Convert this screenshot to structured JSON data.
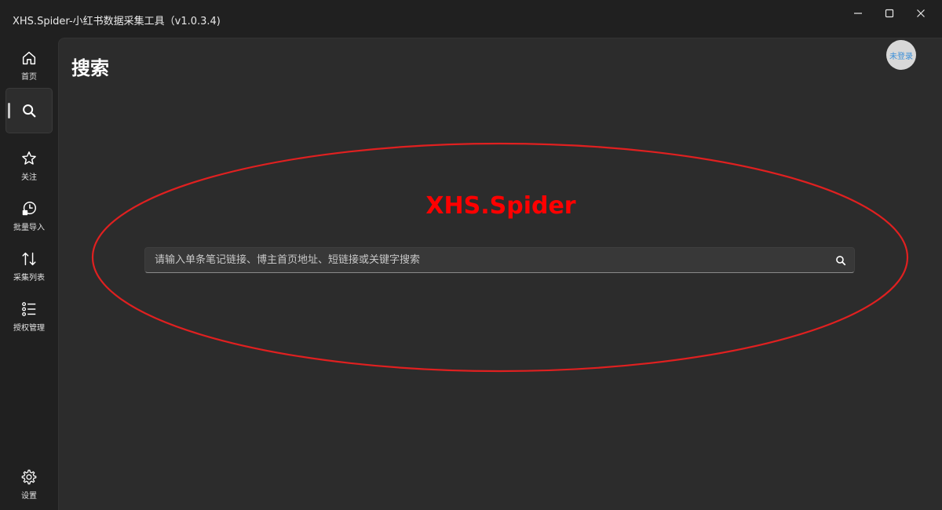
{
  "window": {
    "title": "XHS.Spider-小红书数据采集工具（v1.0.3.4)",
    "controls": [
      "minimize-icon",
      "maximize-icon",
      "close-icon"
    ]
  },
  "sidebar": {
    "items": [
      {
        "label": "首页",
        "icon": "home-icon",
        "active": false
      },
      {
        "label": "",
        "icon": "search-icon",
        "active": true
      },
      {
        "label": "关注",
        "icon": "star-icon",
        "active": false
      },
      {
        "label": "批量导入",
        "icon": "history-icon",
        "active": false
      },
      {
        "label": "采集列表",
        "icon": "sort-arrows-icon",
        "active": false
      },
      {
        "label": "授权管理",
        "icon": "list-icon",
        "active": false
      }
    ],
    "settings": {
      "label": "设置",
      "icon": "gear-icon"
    }
  },
  "main": {
    "title": "搜索",
    "avatar_label": "未登录",
    "brand": "XHS.Spider",
    "search": {
      "placeholder": "请输入单条笔记链接、博主首页地址、短链接或关键字搜索",
      "value": ""
    }
  },
  "colors": {
    "brand": "#ff0000",
    "annotation": "#e02020",
    "background": "#202020",
    "panel": "#2c2c2c",
    "avatar_text": "#3b8fd9"
  }
}
